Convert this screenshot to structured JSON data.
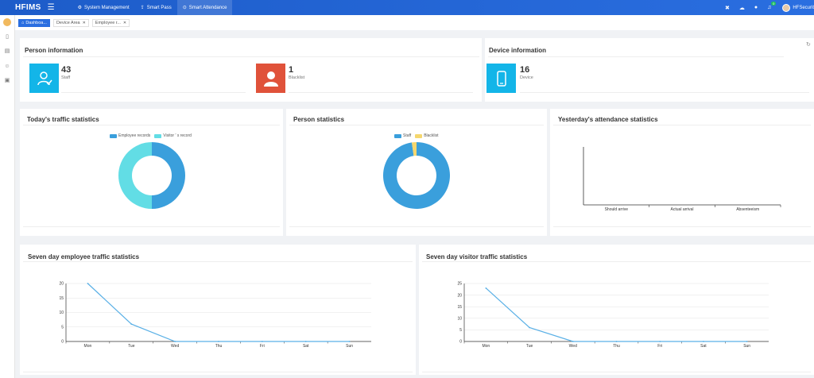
{
  "topbar": {
    "brand": "HFIMS",
    "nav": [
      {
        "icon": "gear-icon",
        "glyph": "⚙",
        "label": "System Management"
      },
      {
        "icon": "signpost-icon",
        "glyph": "⇪",
        "label": "Smart Pass"
      },
      {
        "icon": "location-icon",
        "glyph": "⊙",
        "label": "Smart Attendance"
      }
    ],
    "notification_count": "0",
    "username": "HFSecurit"
  },
  "tabs": [
    {
      "label": "Dashboa...",
      "active": true
    },
    {
      "label": "Device Area",
      "active": false
    },
    {
      "label": "Employee r...",
      "active": false
    }
  ],
  "person_info": {
    "title": "Person information",
    "cards": [
      {
        "value": "43",
        "label": "Staff",
        "color": "#13b5e8"
      },
      {
        "value": "1",
        "label": "Blacklist",
        "color": "#e0523a"
      }
    ]
  },
  "device_info": {
    "title": "Device information",
    "card": {
      "value": "16",
      "label": "Device",
      "color": "#13b5e8"
    }
  },
  "traffic_today": {
    "title": "Today's traffic statistics",
    "chart_data": {
      "type": "pie",
      "labels": [
        "Employee records",
        "Visitor ' s record"
      ],
      "values": [
        50,
        50
      ],
      "colors": [
        "#3a9fdc",
        "#62dde5"
      ]
    }
  },
  "person_stats": {
    "title": "Person statistics",
    "chart_data": {
      "type": "pie",
      "labels": [
        "Staff",
        "Blacklist"
      ],
      "values": [
        43,
        1
      ],
      "colors": [
        "#3a9fdc",
        "#f5d76e"
      ]
    }
  },
  "attendance_yesterday": {
    "title": "Yesterday's attendance statistics",
    "chart_data": {
      "type": "bar",
      "categories": [
        "Should arrive",
        "Actual arrival",
        "Absenteeism"
      ],
      "values": [
        0,
        0,
        0
      ]
    }
  },
  "employee_week": {
    "title": "Seven day employee traffic statistics",
    "chart_data": {
      "type": "line",
      "categories": [
        "Mon",
        "Tue",
        "Wed",
        "Thu",
        "Fri",
        "Sat",
        "Sun"
      ],
      "values": [
        20,
        6,
        0,
        0,
        0,
        0,
        0
      ],
      "yticks": [
        0,
        5,
        10,
        15,
        20
      ],
      "ylim": [
        0,
        20
      ],
      "color": "#5ab0e6"
    }
  },
  "visitor_week": {
    "title": "Seven day visitor traffic statistics",
    "chart_data": {
      "type": "line",
      "categories": [
        "Mon",
        "Tue",
        "Wed",
        "Thu",
        "Fri",
        "Sat",
        "Sun"
      ],
      "values": [
        23,
        6,
        0,
        0,
        0,
        0,
        0
      ],
      "yticks": [
        0,
        5,
        10,
        15,
        20,
        25
      ],
      "ylim": [
        0,
        25
      ],
      "color": "#5ab0e6"
    }
  }
}
